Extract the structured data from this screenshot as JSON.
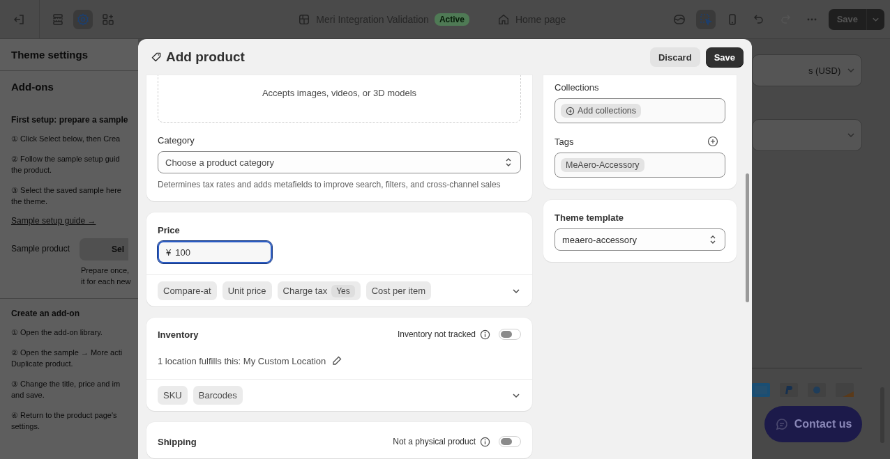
{
  "topbar": {
    "left_tools": [
      {
        "kind": "exit",
        "selected": false
      },
      {
        "kind": "sections",
        "selected": false
      },
      {
        "kind": "settings",
        "selected": true
      },
      {
        "kind": "apps",
        "selected": false
      }
    ],
    "store": {
      "name": "Meri Integration Validation",
      "status": "Active"
    },
    "page": "Home page",
    "right_tools": [
      {
        "kind": "inspector",
        "selected": false,
        "disabled": false
      },
      {
        "kind": "select",
        "selected": true,
        "disabled": false
      },
      {
        "kind": "mobile",
        "selected": false,
        "disabled": false
      },
      {
        "kind": "undo",
        "selected": false,
        "disabled": false
      },
      {
        "kind": "redo",
        "selected": false,
        "disabled": true
      },
      {
        "kind": "more",
        "selected": false,
        "disabled": false
      }
    ],
    "save": "Save"
  },
  "sidebar": {
    "title": "Theme settings",
    "subtitle": "Add-ons",
    "sections": [
      {
        "heading": "First setup: prepare a sample",
        "steps": [
          [
            "① Click Select below, then Crea"
          ],
          [
            "② Follow the sample setup guid",
            "the product."
          ],
          [
            "③ Select the saved sample here",
            "the theme."
          ]
        ],
        "link": "Sample setup guide →",
        "field": {
          "label": "Sample product",
          "button": "Sel",
          "hint": [
            "Prepare once,",
            "it for each new"
          ]
        }
      },
      {
        "heading": "Create an add-on",
        "steps": [
          [
            "① Open the add-on library."
          ],
          [
            "② Open the sample → More acti",
            "Duplicate product."
          ],
          [
            "③ Change the title, price and im",
            "and save."
          ],
          [
            "④ Return to the product page's",
            "settings."
          ]
        ]
      }
    ]
  },
  "modal": {
    "title": "Add product",
    "discard": "Discard",
    "save": "Save",
    "media_hint": "Accepts images, videos, or 3D models",
    "category": {
      "label": "Category",
      "placeholder": "Choose a product category",
      "help": "Determines tax rates and adds metafields to improve search, filters, and cross-channel sales"
    },
    "price": {
      "label": "Price",
      "currency": "¥",
      "value": "100",
      "focused": true,
      "pills": [
        {
          "label": "Compare-at"
        },
        {
          "label": "Unit price"
        },
        {
          "label": "Charge tax",
          "badge": "Yes"
        },
        {
          "label": "Cost per item"
        }
      ]
    },
    "inventory": {
      "heading": "Inventory",
      "tracking_label": "Inventory not tracked",
      "tracking_on": false,
      "location": "1 location fulfills this: My Custom Location",
      "pills": [
        {
          "label": "SKU"
        },
        {
          "label": "Barcodes"
        }
      ]
    },
    "shipping": {
      "heading": "Shipping",
      "physical_label": "Not a physical product",
      "on": false
    },
    "collections": {
      "label": "Collections",
      "chip": "Add collections"
    },
    "tags": {
      "label": "Tags",
      "chips": [
        "MeAero-Accessory"
      ]
    },
    "template": {
      "heading": "Theme template",
      "value": "meaero-accessory"
    }
  },
  "preview": {
    "currency_select": "s (USD)",
    "contact": "Contact us"
  }
}
